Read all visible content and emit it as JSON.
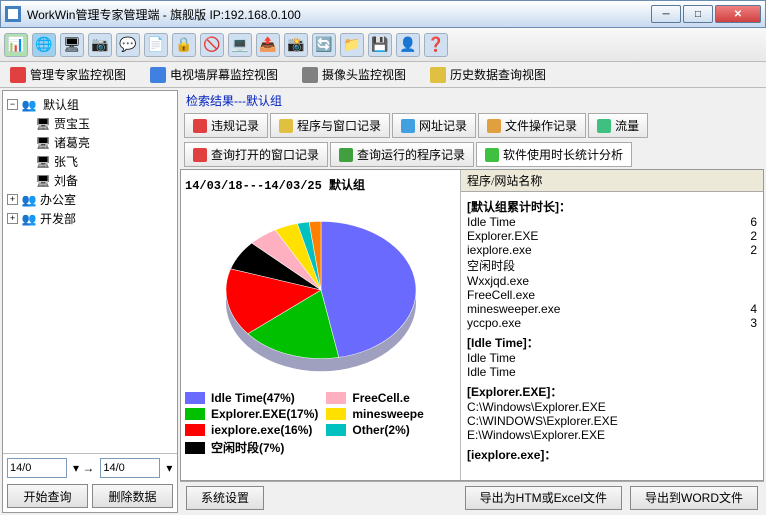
{
  "window": {
    "title": "WorkWin管理专家管理端 - 旗舰版 IP:192.168.0.100"
  },
  "viewtabs": {
    "t1": "管理专家监控视图",
    "t2": "电视墙屏幕监控视图",
    "t3": "摄像头监控视图",
    "t4": "历史数据查询视图"
  },
  "tree": {
    "root": "默认组",
    "u1": "贾宝玉",
    "u2": "诸葛亮",
    "u3": "张飞",
    "u4": "刘备",
    "g2": "办公室",
    "g3": "开发部"
  },
  "dates": {
    "from": "14/0",
    "to": "14/0"
  },
  "buttons": {
    "query": "开始查询",
    "delete": "删除数据",
    "sys": "系统设置",
    "exphtml": "导出为HTM或Excel文件",
    "expword": "导出到WORD文件"
  },
  "search_result": "检索结果---默认组",
  "rectabs": {
    "r1": "违规记录",
    "r2": "程序与窗口记录",
    "r3": "网址记录",
    "r4": "文件操作记录",
    "r5": "流量",
    "r6": "查询打开的窗口记录",
    "r7": "查询运行的程序记录",
    "r8": "软件使用时长统计分析"
  },
  "chart_header": "14/03/18---14/03/25   默认组",
  "chart_data": {
    "type": "pie",
    "title": "14/03/18---14/03/25   默认组",
    "series": [
      {
        "name": "Idle Time",
        "value": 47,
        "color": "#6a6aff"
      },
      {
        "name": "Explorer.EXE",
        "value": 17,
        "color": "#00c000"
      },
      {
        "name": "iexplore.exe",
        "value": 16,
        "color": "#ff0000"
      },
      {
        "name": "空闲时段",
        "value": 7,
        "color": "#000000"
      },
      {
        "name": "FreeCell.exe",
        "value": 5,
        "color": "#ffb0c0"
      },
      {
        "name": "minesweeper.exe",
        "value": 4,
        "color": "#ffe000"
      },
      {
        "name": "Other",
        "value": 2,
        "color": "#00c0c0"
      },
      {
        "name": "yccpo/wxxjqd",
        "value": 2,
        "color": "#ff8000"
      }
    ]
  },
  "legend": {
    "l1": "Idle Time(47%)",
    "l2": "Explorer.EXE(17%)",
    "l3": "iexplore.exe(16%)",
    "l4": "空闲时段(7%)",
    "l5": "FreeCell.e",
    "l6": "minesweepe",
    "l7": "Other(2%)"
  },
  "list": {
    "header": "程序/网站名称",
    "g1": "[默认组累计时长]：",
    "i1n": "Idle Time",
    "i1v": "6",
    "i2n": "Explorer.EXE",
    "i2v": "2",
    "i3n": "iexplore.exe",
    "i3v": "2",
    "i4n": "空闲时段",
    "i5n": "Wxxjqd.exe",
    "i6n": "FreeCell.exe",
    "i7n": "minesweeper.exe",
    "i7v": "4",
    "i8n": "yccpo.exe",
    "i8v": "3",
    "g2": "[Idle Time]：",
    "j1": "Idle Time",
    "j2": "Idle Time",
    "g3": "[Explorer.EXE]：",
    "k1": "C:\\Windows\\Explorer.EXE",
    "k2": "C:\\WINDOWS\\Explorer.EXE",
    "k3": "E:\\Windows\\Explorer.EXE",
    "g4": "[iexplore.exe]："
  }
}
